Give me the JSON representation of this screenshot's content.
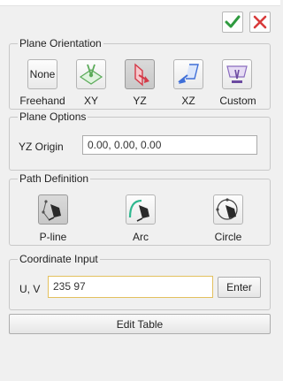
{
  "window": {
    "confirm_icon": "checkmark-icon",
    "cancel_icon": "close-icon",
    "accent_ok": "#2e9a3e",
    "accent_cancel": "#d83a3a"
  },
  "plane_orientation": {
    "legend": "Plane Orientation",
    "selected": "YZ",
    "items": [
      {
        "label": "Freehand",
        "button_text": "None",
        "icon": "none"
      },
      {
        "label": "XY",
        "icon": "xy-plane-icon"
      },
      {
        "label": "YZ",
        "icon": "yz-plane-icon"
      },
      {
        "label": "XZ",
        "icon": "xz-plane-icon"
      },
      {
        "label": "Custom",
        "icon": "custom-plane-icon"
      }
    ]
  },
  "plane_options": {
    "legend": "Plane Options",
    "origin_label": "YZ Origin",
    "origin_value": "0.00, 0.00, 0.00"
  },
  "path_definition": {
    "legend": "Path Definition",
    "selected": "P-line",
    "items": [
      {
        "label": "P-line",
        "icon": "polyline-pen-icon"
      },
      {
        "label": "Arc",
        "icon": "arc-pen-icon"
      },
      {
        "label": "Circle",
        "icon": "circle-pen-icon"
      }
    ]
  },
  "coordinate_input": {
    "legend": "Coordinate Input",
    "label": "U, V",
    "value": "235 97",
    "enter_label": "Enter",
    "focus_color": "#e3c05e"
  },
  "edit_table": {
    "label": "Edit Table"
  }
}
